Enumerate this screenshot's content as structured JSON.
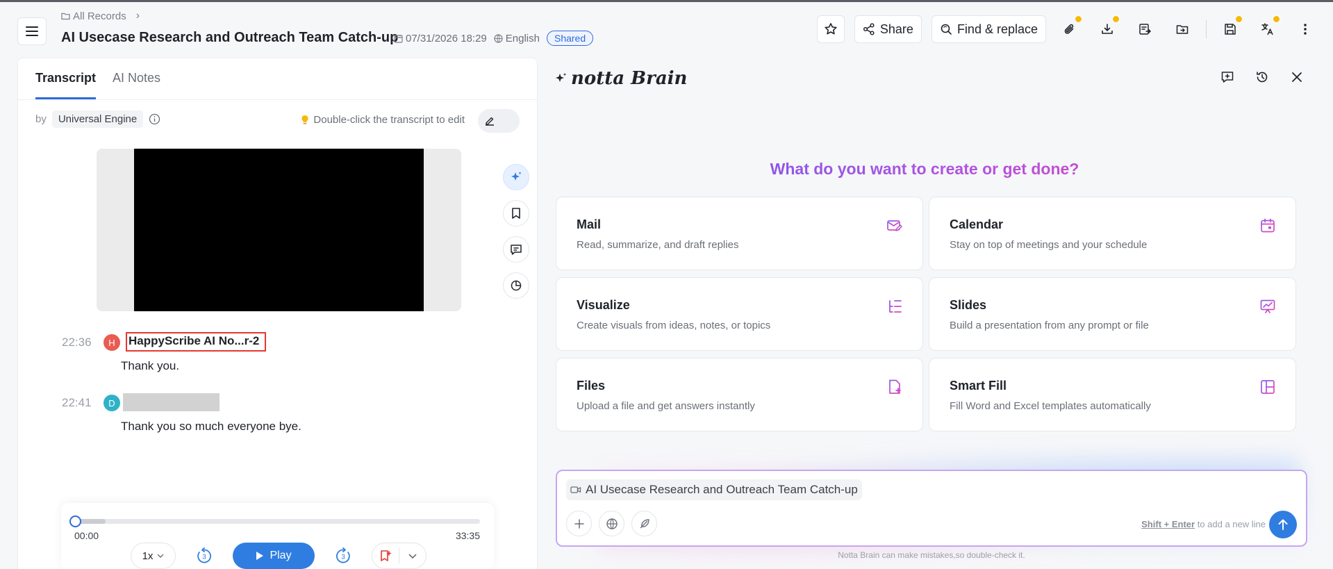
{
  "breadcrumb": {
    "label": "All Records"
  },
  "document": {
    "title": "AI Usecase Research and Outreach Team Catch-up",
    "datetime": "07/31/2026 18:29",
    "language": "English",
    "status": "Shared"
  },
  "toolbar": {
    "share_label": "Share",
    "find_replace_label": "Find & replace",
    "icons": [
      "star-icon",
      "share-icon",
      "search-replace-icon",
      "attachment-icon",
      "download-icon",
      "export-icon",
      "folder-icon",
      "save-icon",
      "translate-icon",
      "more-icon"
    ],
    "badge_color": "#f5b90a"
  },
  "transcript_panel": {
    "tabs": [
      {
        "label": "Transcript",
        "active": true
      },
      {
        "label": "AI Notes",
        "active": false
      }
    ],
    "engine_prefix": "by",
    "engine_name": "Universal Engine",
    "edit_hint": "Double-click the transcript to edit",
    "segments": [
      {
        "time": "22:36",
        "initial": "H",
        "avatar_color": "#ea5b52",
        "speaker": "HappyScribe AI No...r-2",
        "text": "Thank you."
      },
      {
        "time": "22:41",
        "initial": "D",
        "avatar_color": "#2fb2c7",
        "speaker": "",
        "text": "Thank you so much everyone bye."
      }
    ]
  },
  "player": {
    "current_time": "00:00",
    "duration": "33:35",
    "progress": 0,
    "speed": "1x",
    "skip_back": "3",
    "skip_forward": "3",
    "play_label": "Play",
    "accent": "#2f7de1"
  },
  "brain": {
    "name": "notta Brain",
    "headline": "What do you want to create or get done?",
    "cards": [
      {
        "title": "Mail",
        "description": "Read, summarize, and draft replies",
        "icon": "mail-edit-icon"
      },
      {
        "title": "Calendar",
        "description": "Stay on top of meetings and your schedule",
        "icon": "calendar-icon"
      },
      {
        "title": "Visualize",
        "description": "Create visuals from ideas, notes, or topics",
        "icon": "visualize-icon"
      },
      {
        "title": "Slides",
        "description": "Build a presentation from any prompt or file",
        "icon": "presentation-icon"
      },
      {
        "title": "Files",
        "description": "Upload a file and get answers instantly",
        "icon": "file-add-icon"
      },
      {
        "title": "Smart Fill",
        "description": "Fill Word and Excel templates automatically",
        "icon": "layout-icon"
      }
    ],
    "composer": {
      "context_label": "AI Usecase Research and Outreach Team Catch-up",
      "hint_keys": "Shift + Enter",
      "hint_text": "to add a new line"
    },
    "disclaimer": "Notta Brain can make mistakes,so double-check it."
  }
}
